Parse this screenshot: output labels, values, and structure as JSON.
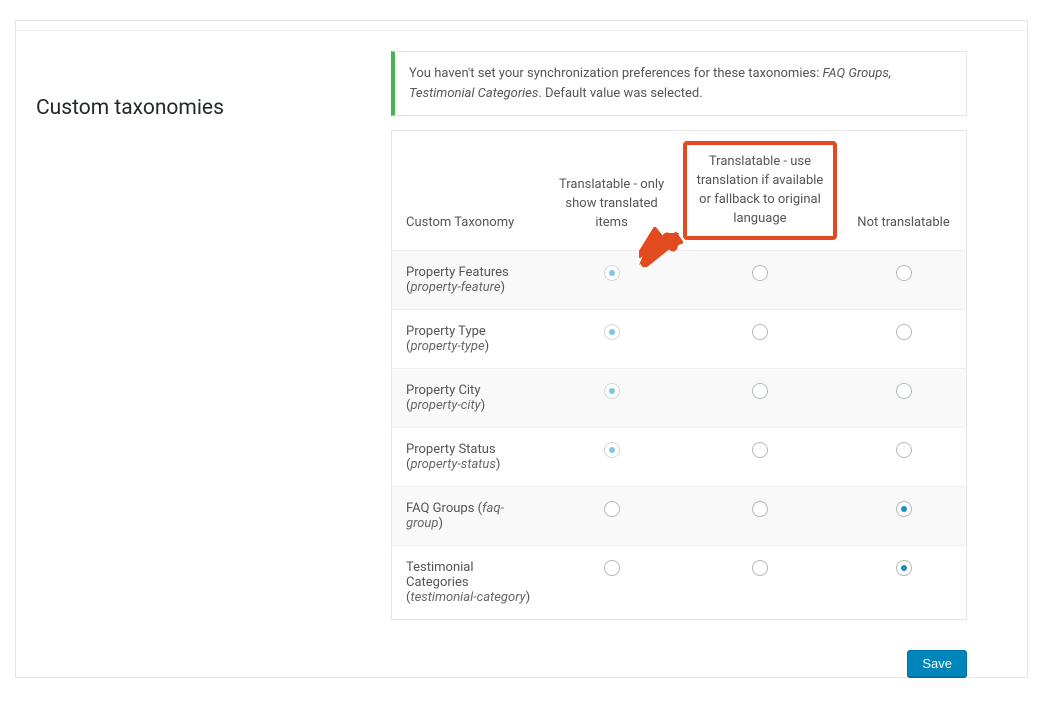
{
  "section_title": "Custom taxonomies",
  "notice": {
    "prefix": "You haven't set your synchronization preferences for these taxonomies: ",
    "items": "FAQ Groups, Testimonial Categories",
    "suffix": ". Default value was selected."
  },
  "columns": {
    "col0": "Custom Taxonomy",
    "col1": "Translatable - only show translated items",
    "col2": "Translatable - use translation if available or fallback to original language",
    "col3": "Not translatable"
  },
  "rows": [
    {
      "label": "Property Features",
      "slug": "property-feature",
      "selected": 1,
      "soft": true
    },
    {
      "label": "Property Type",
      "slug": "property-type",
      "selected": 1,
      "soft": true
    },
    {
      "label": "Property City",
      "slug": "property-city",
      "selected": 1,
      "soft": true
    },
    {
      "label": "Property Status",
      "slug": "property-status",
      "selected": 1,
      "soft": true
    },
    {
      "label": "FAQ Groups",
      "slug": "faq-group",
      "selected": 3,
      "soft": false
    },
    {
      "label": "Testimonial Categories",
      "slug": "testimonial-category",
      "selected": 3,
      "soft": false
    }
  ],
  "save_label": "Save"
}
